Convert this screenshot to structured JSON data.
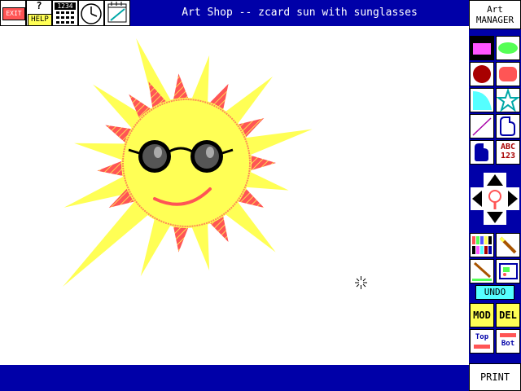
{
  "title": "Art Shop -- zcard sun with sunglasses",
  "toolbar": {
    "exit_label": "EXIT",
    "help_label": "HELP",
    "help_mark": "?",
    "counter_label": "1234"
  },
  "panel": {
    "manager_line1": "Art",
    "manager_line2": "MANAGER",
    "text_tool_line1": "ABC",
    "text_tool_line2": "123",
    "undo_label": "UNDO",
    "mod_label": "MOD",
    "del_label": "DEL",
    "top_label": "Top",
    "bot_label": "Bot",
    "print_label": "PRINT"
  },
  "colors": {
    "bar_blue": "#0000a8",
    "sun_yellow": "#ffff55",
    "ray_orange": "#ff5555",
    "undo_cyan": "#55ffff"
  }
}
